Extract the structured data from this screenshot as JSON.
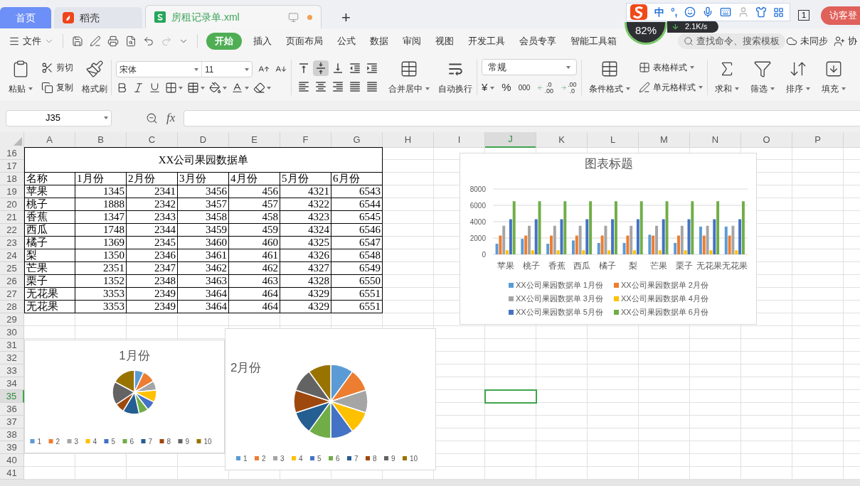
{
  "tabs": [
    {
      "label": "首页",
      "kind": "home",
      "selected": false
    },
    {
      "label": "稻壳",
      "kind": "docer",
      "selected": false
    },
    {
      "label": "房租记录单.xml",
      "kind": "sheet",
      "selected": true,
      "unsaved": true
    }
  ],
  "new_tab": "+",
  "ime_toolbar": {
    "mode": "中",
    "punctuation": "°,"
  },
  "speed_widget": {
    "percent": "82%",
    "speed": "2.1K/s"
  },
  "account": {
    "page_count": "1",
    "guest_button": "访客登"
  },
  "menu": {
    "file": "文件",
    "tabs": [
      {
        "label": "开始",
        "selected": true
      },
      {
        "label": "插入",
        "selected": false
      },
      {
        "label": "页面布局",
        "selected": false
      },
      {
        "label": "公式",
        "selected": false
      },
      {
        "label": "数据",
        "selected": false
      },
      {
        "label": "审阅",
        "selected": false
      },
      {
        "label": "视图",
        "selected": false
      },
      {
        "label": "开发工具",
        "selected": false
      },
      {
        "label": "会员专享",
        "selected": false
      },
      {
        "label": "智能工具箱",
        "selected": false
      }
    ],
    "search_placeholder": "查找命令、搜索模板",
    "sync": "未同步",
    "collab": "协"
  },
  "ribbon": {
    "paste": "粘贴",
    "cut": "剪切",
    "copy": "复制",
    "format_painter": "格式刷",
    "font_name": "宋体",
    "font_size": "11",
    "valign": [
      {
        "selected": false
      },
      {
        "selected": true
      },
      {
        "selected": false
      }
    ],
    "merge": "合并居中",
    "wrap": "自动换行",
    "number_format": "常规",
    "currency": "¥",
    "percent": "%",
    "thousands": "000",
    "decimals": [
      {
        "top": ".0",
        "bottom": ".00"
      },
      {
        "top": ".00",
        "bottom": ".0"
      }
    ],
    "conditional": "条件格式",
    "table_style": "表格样式",
    "cell_style": "单元格样式",
    "sum": "求和",
    "filter": "筛选",
    "sort": "排序",
    "fill": "填充"
  },
  "formula_bar": {
    "name_box": "J35",
    "fx": "fx"
  },
  "columns": [
    {
      "label": "A",
      "selected": false
    },
    {
      "label": "B",
      "selected": false
    },
    {
      "label": "C",
      "selected": false
    },
    {
      "label": "D",
      "selected": false
    },
    {
      "label": "E",
      "selected": false
    },
    {
      "label": "F",
      "selected": false
    },
    {
      "label": "G",
      "selected": false
    },
    {
      "label": "H",
      "selected": false
    },
    {
      "label": "I",
      "selected": false
    },
    {
      "label": "J",
      "selected": true
    },
    {
      "label": "K",
      "selected": false
    },
    {
      "label": "L",
      "selected": false
    },
    {
      "label": "M",
      "selected": false
    },
    {
      "label": "N",
      "selected": false
    },
    {
      "label": "O",
      "selected": false
    },
    {
      "label": "P",
      "selected": false
    }
  ],
  "rows": [
    {
      "label": "16",
      "selected": false
    },
    {
      "label": "17",
      "selected": false
    },
    {
      "label": "18",
      "selected": false
    },
    {
      "label": "19",
      "selected": false
    },
    {
      "label": "20",
      "selected": false
    },
    {
      "label": "21",
      "selected": false
    },
    {
      "label": "22",
      "selected": false
    },
    {
      "label": "23",
      "selected": false
    },
    {
      "label": "24",
      "selected": false
    },
    {
      "label": "25",
      "selected": false
    },
    {
      "label": "26",
      "selected": false
    },
    {
      "label": "27",
      "selected": false
    },
    {
      "label": "28",
      "selected": false
    },
    {
      "label": "29",
      "selected": false
    },
    {
      "label": "30",
      "selected": false
    },
    {
      "label": "31",
      "selected": false
    },
    {
      "label": "32",
      "selected": false
    },
    {
      "label": "33",
      "selected": false
    },
    {
      "label": "34",
      "selected": false
    },
    {
      "label": "35",
      "selected": true
    },
    {
      "label": "36",
      "selected": false
    },
    {
      "label": "37",
      "selected": false
    },
    {
      "label": "38",
      "selected": false
    },
    {
      "label": "39",
      "selected": false
    },
    {
      "label": "40",
      "selected": false
    },
    {
      "label": "41",
      "selected": false
    }
  ],
  "sheet_table": {
    "title": "XX公司果园数据单",
    "header": [
      "名称",
      "1月份",
      "2月份",
      "3月份",
      "4月份",
      "5月份",
      "6月份"
    ],
    "rows": [
      [
        "苹果",
        "1345",
        "2341",
        "3456",
        "456",
        "4321",
        "6543"
      ],
      [
        "桃子",
        "1888",
        "2342",
        "3457",
        "457",
        "4322",
        "6544"
      ],
      [
        "香蕉",
        "1347",
        "2343",
        "3458",
        "458",
        "4323",
        "6545"
      ],
      [
        "西瓜",
        "1748",
        "2344",
        "3459",
        "459",
        "4324",
        "6546"
      ],
      [
        "橘子",
        "1369",
        "2345",
        "3460",
        "460",
        "4325",
        "6547"
      ],
      [
        "梨",
        "1350",
        "2346",
        "3461",
        "461",
        "4326",
        "6548"
      ],
      [
        "芒果",
        "2351",
        "2347",
        "3462",
        "462",
        "4327",
        "6549"
      ],
      [
        "栗子",
        "1352",
        "2348",
        "3463",
        "463",
        "4328",
        "6550"
      ],
      [
        "无花果",
        "3353",
        "2349",
        "3464",
        "464",
        "4329",
        "6551"
      ],
      [
        "无花果",
        "3353",
        "2349",
        "3464",
        "464",
        "4329",
        "6551"
      ]
    ]
  },
  "bar_chart": {
    "chart_data": {
      "type": "bar",
      "title": "图表标题",
      "categories": [
        "苹果",
        "桃子",
        "香蕉",
        "西瓜",
        "橘子",
        "梨",
        "芒果",
        "栗子",
        "无花果",
        "无花果"
      ],
      "ylim": [
        0,
        8000
      ],
      "yticks": [
        0,
        2000,
        4000,
        6000,
        8000
      ],
      "grid": true,
      "legend": "bottom",
      "series": [
        {
          "name": "XX公司果园数据单 1月份",
          "color": "#5b9bd5",
          "values": [
            1300,
            1900,
            1300,
            1700,
            1400,
            1400,
            2400,
            1400,
            3400,
            3400
          ]
        },
        {
          "name": "XX公司果园数据单 2月份",
          "color": "#ed7d31",
          "values": [
            2300,
            2300,
            2300,
            2300,
            2300,
            2300,
            2300,
            2300,
            2300,
            2300
          ]
        },
        {
          "name": "XX公司果园数据单 3月份",
          "color": "#a5a5a5",
          "values": [
            3500,
            3500,
            3500,
            3500,
            3500,
            3500,
            3500,
            3500,
            3500,
            3500
          ]
        },
        {
          "name": "XX公司果园数据单 4月份",
          "color": "#ffc000",
          "values": [
            500,
            500,
            500,
            500,
            500,
            500,
            500,
            500,
            500,
            500
          ]
        },
        {
          "name": "XX公司果园数据单 5月份",
          "color": "#4472c4",
          "values": [
            4300,
            4300,
            4300,
            4300,
            4300,
            4300,
            4300,
            4300,
            4300,
            4300
          ]
        },
        {
          "name": "XX公司果园数据单 6月份",
          "color": "#70ad47",
          "values": [
            6500,
            6500,
            6500,
            6500,
            6500,
            6500,
            6500,
            6500,
            6500,
            6500
          ]
        }
      ]
    }
  },
  "pie_charts": [
    {
      "chart_data": {
        "type": "pie",
        "title": "1月份",
        "legend": "bottom",
        "categories": [
          "1",
          "2",
          "3",
          "4",
          "5",
          "6",
          "7",
          "8",
          "9",
          "10"
        ],
        "values": [
          6.9,
          9.7,
          6.9,
          9.0,
          7.0,
          7.0,
          12.1,
          7.0,
          17.2,
          17.2
        ]
      }
    },
    {
      "chart_data": {
        "type": "pie",
        "title": "2月份",
        "legend": "bottom",
        "categories": [
          "1",
          "2",
          "3",
          "4",
          "5",
          "6",
          "7",
          "8",
          "9",
          "10"
        ],
        "values": [
          10,
          10,
          10,
          10,
          10,
          10,
          10,
          10,
          10,
          10
        ]
      }
    }
  ]
}
